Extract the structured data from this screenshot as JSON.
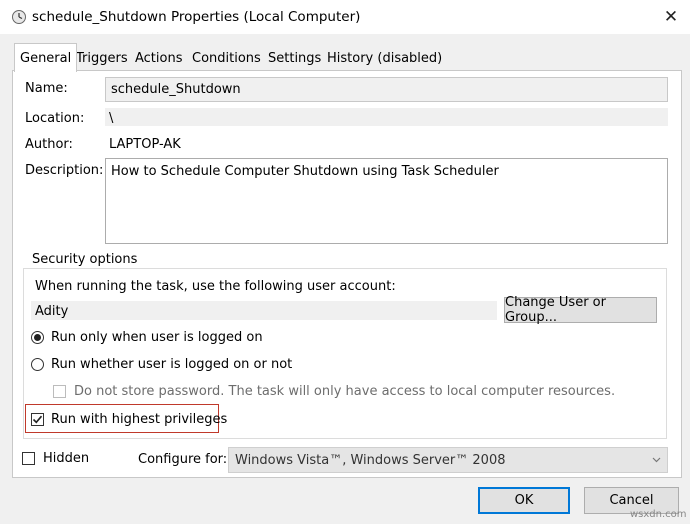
{
  "window": {
    "title": "schedule_Shutdown Properties (Local Computer)",
    "close_glyph": "✕"
  },
  "tabs": [
    {
      "label": "General",
      "active": true
    },
    {
      "label": "Triggers"
    },
    {
      "label": "Actions"
    },
    {
      "label": "Conditions"
    },
    {
      "label": "Settings"
    },
    {
      "label": "History (disabled)"
    }
  ],
  "general": {
    "name_label": "Name:",
    "name_value": "schedule_Shutdown",
    "location_label": "Location:",
    "location_value": "\\",
    "author_label": "Author:",
    "author_value": "LAPTOP-AK",
    "description_label": "Description:",
    "description_value": "How to Schedule Computer Shutdown using Task Scheduler"
  },
  "security": {
    "group_title": "Security options",
    "account_prompt": "When running the task, use the following user account:",
    "account_value": "Adity",
    "change_button": "Change User or Group...",
    "radio_logged_on": "Run only when user is logged on",
    "radio_logged_on_selected": true,
    "radio_logged_or_not": "Run whether user is logged on or not",
    "no_store_password": "Do not store password.  The task will only have access to local computer resources.",
    "highest_privileges": "Run with highest privileges",
    "highest_privileges_checked": true
  },
  "footer": {
    "hidden_label": "Hidden",
    "hidden_checked": false,
    "configure_label": "Configure for:",
    "configure_value": "Windows Vista™, Windows Server™ 2008",
    "ok_button": "OK",
    "cancel_button": "Cancel"
  },
  "watermark": "wsxdn.com",
  "colors": {
    "highlight_box": "#c0392b",
    "default_button_border": "#0078d7"
  }
}
